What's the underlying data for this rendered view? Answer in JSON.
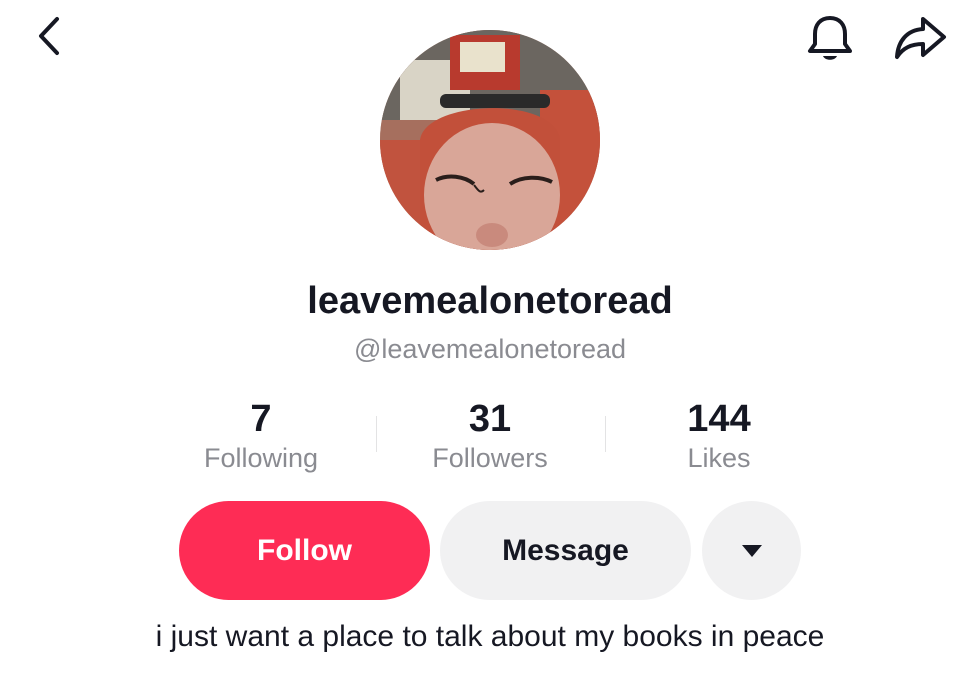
{
  "header": {
    "back_icon": "chevron-left-icon",
    "notification_icon": "bell-icon",
    "share_icon": "share-arrow-icon"
  },
  "profile": {
    "display_name": "leavemealonetoread",
    "handle": "@leavemealonetoread",
    "bio": "i just want a place to talk about my books in peace"
  },
  "stats": {
    "following": {
      "value": "7",
      "label": "Following"
    },
    "followers": {
      "value": "31",
      "label": "Followers"
    },
    "likes": {
      "value": "144",
      "label": "Likes"
    }
  },
  "actions": {
    "follow_label": "Follow",
    "message_label": "Message",
    "more_icon": "caret-down-icon"
  },
  "colors": {
    "accent": "#fe2c55",
    "secondary_button": "#f1f1f2",
    "muted_text": "#8a8b91",
    "primary_text": "#161823"
  }
}
